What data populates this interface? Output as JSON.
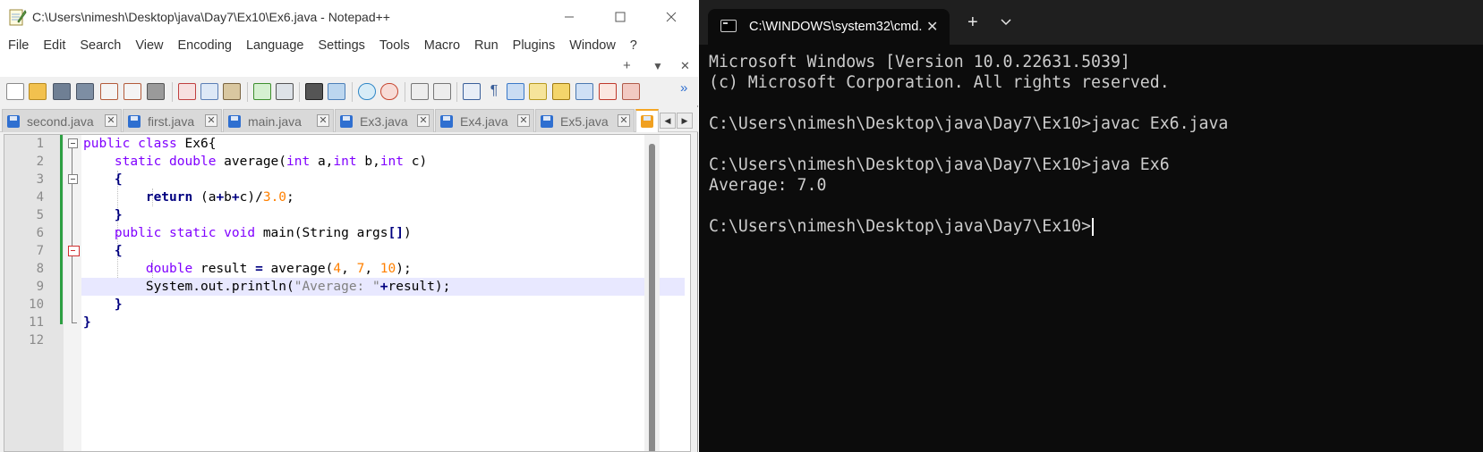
{
  "notepad": {
    "title": "C:\\Users\\nimesh\\Desktop\\java\\Day7\\Ex10\\Ex6.java - Notepad++",
    "menu": [
      "File",
      "Edit",
      "Search",
      "View",
      "Encoding",
      "Language",
      "Settings",
      "Tools",
      "Macro",
      "Run",
      "Plugins",
      "Window",
      "?"
    ],
    "sub_controls": {
      "plus": "+",
      "down": "▼",
      "close": "✕"
    },
    "tabs": [
      {
        "label": "second.java",
        "close": "✕"
      },
      {
        "label": "first.java",
        "close": "✕"
      },
      {
        "label": "main.java",
        "close": "✕"
      },
      {
        "label": "Ex3.java",
        "close": "✕"
      },
      {
        "label": "Ex4.java",
        "close": "✕"
      },
      {
        "label": "Ex5.java",
        "close": "✕"
      }
    ],
    "line_numbers": [
      "1",
      "2",
      "3",
      "4",
      "5",
      "6",
      "7",
      "8",
      "9",
      "10",
      "11",
      "12"
    ],
    "code": {
      "l1_kw1": "public",
      "l1_kw2": "class",
      "l1_rest": " Ex6{",
      "l2_kw1": "static",
      "l2_kw2": "double",
      "l2_name": " average(",
      "l2_t1": "int",
      "l2_a": " a,",
      "l2_t2": "int",
      "l2_b": " b,",
      "l2_t3": "int",
      "l2_c": " c)",
      "l3": "{",
      "l4_kw": "return",
      "l4_expr": " (a",
      "l4_op1": "+",
      "l4_b": "b",
      "l4_op2": "+",
      "l4_c": "c)/",
      "l4_num": "3.0",
      "l4_end": ";",
      "l5": "}",
      "l6_kw1": "public",
      "l6_kw2": "static",
      "l6_kw3": "void",
      "l6_rest": " main(String args",
      "l6_br": "[]",
      "l6_end": ")",
      "l7": "{",
      "l8_type": "double",
      "l8_mid": " result ",
      "l8_eq": "=",
      "l8_call": " average(",
      "l8_n1": "4",
      "l8_s1": ", ",
      "l8_n2": "7",
      "l8_s2": ", ",
      "l8_n3": "10",
      "l8_end": ");",
      "l9_pre": "System.out.println(",
      "l9_str": "\"Average: \"",
      "l9_op": "+",
      "l9_end": "result);",
      "l10": "}",
      "l11": "}"
    }
  },
  "terminal": {
    "tab_title": "C:\\WINDOWS\\system32\\cmd.",
    "tab_close": "✕",
    "new_tab": "+",
    "dropdown": "⌄",
    "lines": [
      "Microsoft Windows [Version 10.0.22631.5039]",
      "(c) Microsoft Corporation. All rights reserved.",
      "",
      "C:\\Users\\nimesh\\Desktop\\java\\Day7\\Ex10>javac Ex6.java",
      "",
      "C:\\Users\\nimesh\\Desktop\\java\\Day7\\Ex10>java Ex6",
      "Average: 7.0",
      "",
      "C:\\Users\\nimesh\\Desktop\\java\\Day7\\Ex10>"
    ]
  },
  "colors": {
    "keyword": "#8000ff",
    "number": "#ff8000",
    "string": "#808080",
    "terminal_bg": "#0c0c0c",
    "terminal_text": "#cccccc",
    "current_line": "#e8e8ff"
  }
}
